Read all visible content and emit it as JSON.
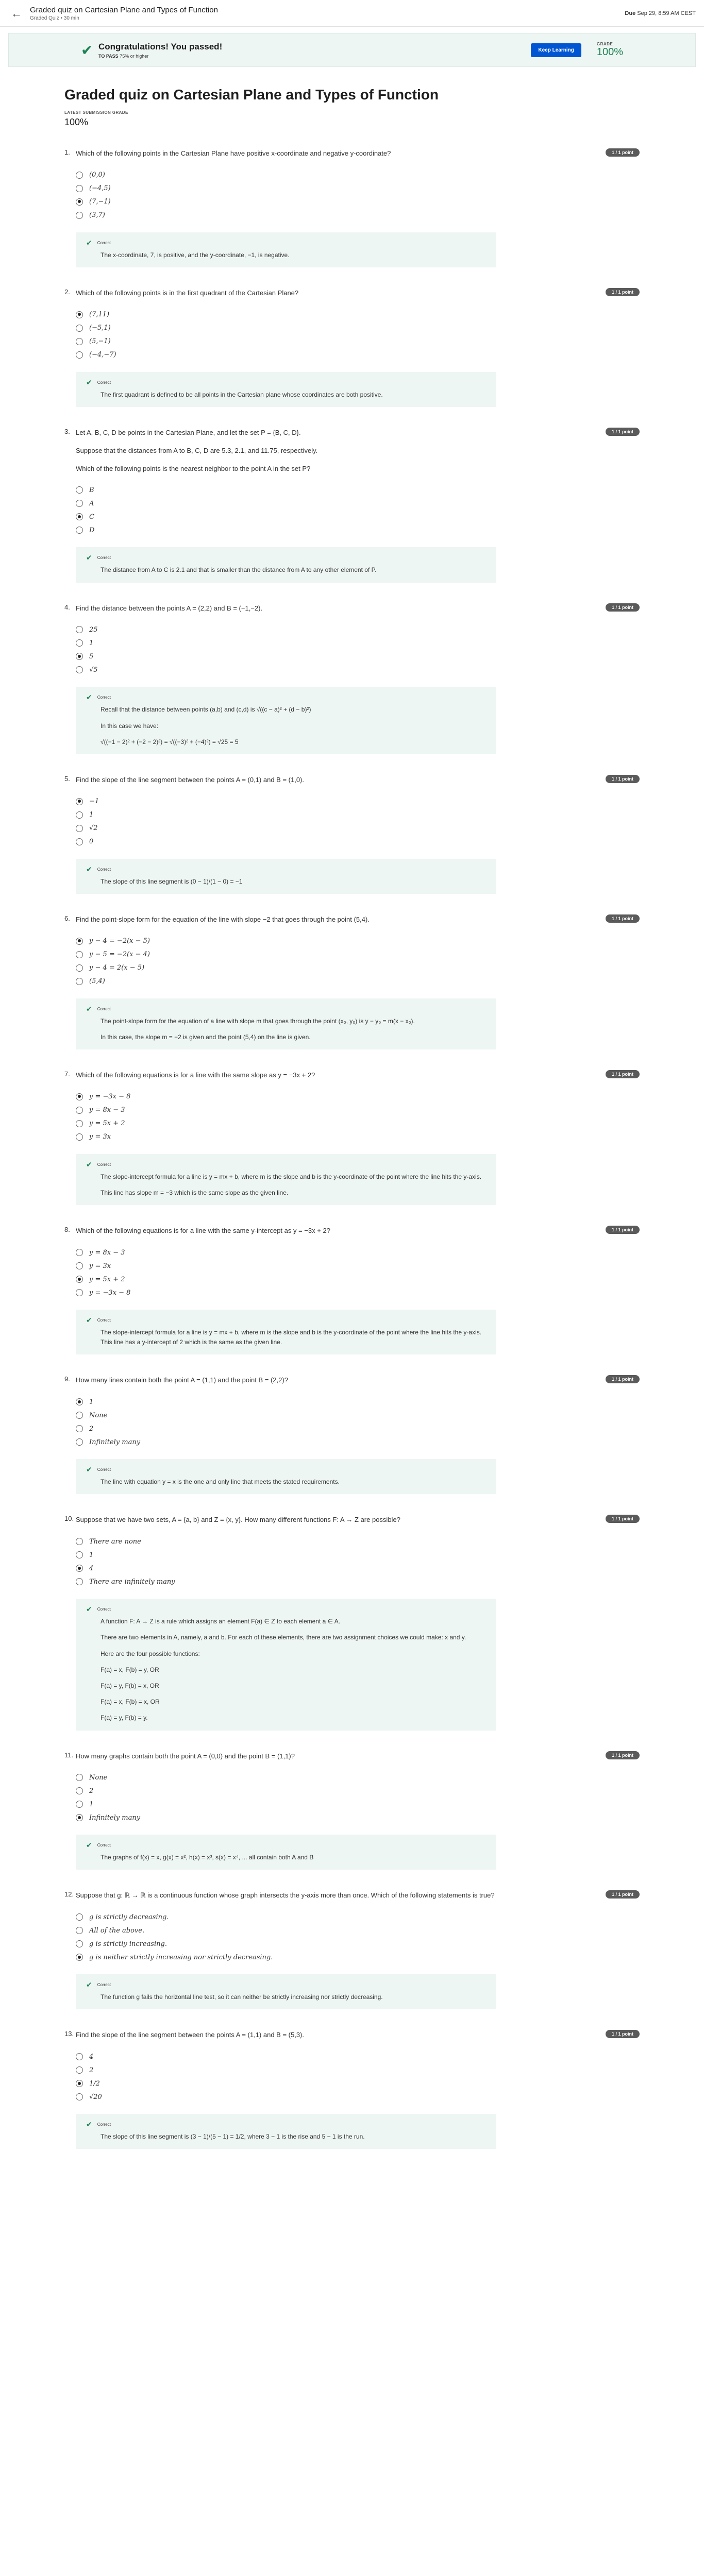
{
  "header": {
    "title": "Graded quiz on Cartesian Plane and Types of Function",
    "subtitle": "Graded Quiz • 30 min",
    "due_label": "Due",
    "due_value": "Sep 29, 8:59 AM CEST",
    "back_icon": "arrow-left-icon"
  },
  "banner": {
    "heading": "Congratulations! You passed!",
    "to_pass_label": "TO PASS",
    "to_pass_value": "75% or higher",
    "button": "Keep Learning",
    "grade_label": "GRADE",
    "grade_value": "100%",
    "accent": "#1f8354",
    "button_color": "#0056d2"
  },
  "main": {
    "title": "Graded quiz on Cartesian Plane and Types of Function",
    "latest_label": "LATEST SUBMISSION GRADE",
    "latest_value": "100%"
  },
  "questions": [
    {
      "num": "1.",
      "text": "Which of the following points in the Cartesian Plane have positive x-coordinate and negative y-coordinate?",
      "points": "1 / 1 point",
      "options": [
        "(0,0)",
        "(−4,5)",
        "(7,−1)",
        "(3,7)"
      ],
      "selected": 2,
      "fb_label": "Correct",
      "fb": [
        "The x-coordinate, 7, is positive, and the y-coordinate, −1, is negative."
      ]
    },
    {
      "num": "2.",
      "text": "Which of the following points is in the first quadrant of the Cartesian Plane?",
      "points": "1 / 1 point",
      "options": [
        "(7,11)",
        "(−5,1)",
        "(5,−1)",
        "(−4,−7)"
      ],
      "selected": 0,
      "fb_label": "Correct",
      "fb": [
        "The first quadrant is defined to be all points in the Cartesian plane whose coordinates are both positive."
      ]
    },
    {
      "num": "3.",
      "text": "Let A, B, C, D be points in the Cartesian Plane, and let the set P = {B, C, D}.",
      "sub": [
        "Suppose that the distances from A to B, C, D are 5.3, 2.1, and 11.75, respectively.",
        "Which of the following points is the nearest neighbor to the point A in the set P?"
      ],
      "points": "1 / 1 point",
      "options": [
        "B",
        "A",
        "C",
        "D"
      ],
      "selected": 2,
      "fb_label": "Correct",
      "fb": [
        "The distance from A to C is 2.1 and that is smaller than the distance from A to any other element of P."
      ]
    },
    {
      "num": "4.",
      "text": "Find the distance between the points A = (2,2) and B = (−1,−2).",
      "points": "1 / 1 point",
      "options": [
        "25",
        "1",
        "5",
        "√5"
      ],
      "selected": 2,
      "fb_label": "Correct",
      "fb": [
        "Recall that the distance between points (a,b) and (c,d) is √((c − a)² + (d − b)²)",
        "In this case we have:",
        "√((−1 − 2)² + (−2 − 2)²) = √((−3)² + (−4)²) = √25 = 5"
      ]
    },
    {
      "num": "5.",
      "text": "Find the slope of the line segment between the points A = (0,1) and B = (1,0).",
      "points": "1 / 1 point",
      "options": [
        "−1",
        "1",
        "√2",
        "0"
      ],
      "selected": 0,
      "fb_label": "Correct",
      "fb": [
        "The slope of this line segment is (0 − 1)/(1 − 0) = −1"
      ]
    },
    {
      "num": "6.",
      "text": "Find the point-slope form for the equation of the line with slope −2 that goes through the point (5,4).",
      "points": "1 / 1 point",
      "options": [
        "y − 4 = −2(x − 5)",
        "y − 5 = −2(x − 4)",
        "y − 4 = 2(x − 5)",
        "(5,4)"
      ],
      "selected": 0,
      "fb_label": "Correct",
      "fb": [
        "The point-slope form for the equation of a line with slope m that goes through the point (x₀, y₀) is y − y₀ = m(x − x₀).",
        "In this case, the slope m = −2 is given and the point (5,4) on the line is given."
      ]
    },
    {
      "num": "7.",
      "text": "Which of the following equations is for a line with the same slope as y = −3x + 2?",
      "points": "1 / 1 point",
      "options": [
        "y = −3x − 8",
        "y = 8x − 3",
        "y = 5x + 2",
        "y = 3x"
      ],
      "selected": 0,
      "fb_label": "Correct",
      "fb": [
        "The slope-intercept formula for a line is y = mx + b, where m is the slope and b is the y-coordinate of the point where the line hits the y-axis.",
        "This line has slope m = −3 which is the same slope as the given line."
      ]
    },
    {
      "num": "8.",
      "text": "Which of the following equations is for a line with the same y-intercept as y = −3x + 2?",
      "points": "1 / 1 point",
      "options": [
        "y = 8x − 3",
        "y = 3x",
        "y = 5x + 2",
        "y = −3x − 8"
      ],
      "selected": 2,
      "fb_label": "Correct",
      "fb": [
        "The slope-intercept formula for a line is y = mx + b, where m is the slope and b is the y-coordinate of the point where the line hits the y-axis. This line has a y-intercept of 2 which is the same as the given line."
      ]
    },
    {
      "num": "9.",
      "text": "How many lines contain both the point A = (1,1) and the point B = (2,2)?",
      "points": "1 / 1 point",
      "options": [
        "1",
        "None",
        "2",
        "Infinitely many"
      ],
      "selected": 0,
      "fb_label": "Correct",
      "fb": [
        "The line with equation y = x is the one and only line that meets the stated requirements."
      ]
    },
    {
      "num": "10.",
      "text": "Suppose that we have two sets, A = {a, b} and Z = {x, y}. How many different functions F: A → Z are possible?",
      "points": "1 / 1 point",
      "options": [
        "There are none",
        "1",
        "4",
        "There are infinitely many"
      ],
      "selected": 2,
      "fb_label": "Correct",
      "fb": [
        "A function F: A → Z is a rule which assigns an element F(a) ∈ Z to each element a ∈ A.",
        "There are two elements in A, namely, a and b. For each of these elements, there are two assignment choices we could make: x and y.",
        "Here are the four possible functions:",
        "F(a) = x, F(b) = y, OR",
        "F(a) = y, F(b) = x, OR",
        "F(a) = x, F(b) = x, OR",
        "F(a) = y, F(b) = y."
      ]
    },
    {
      "num": "11.",
      "text": "How many graphs contain both the point A = (0,0) and the point B = (1,1)?",
      "points": "1 / 1 point",
      "options": [
        "None",
        "2",
        "1",
        "Infinitely many"
      ],
      "selected": 3,
      "fb_label": "Correct",
      "fb": [
        "The graphs of f(x) = x, g(x) = x², h(x) = x³, s(x) = x⁴, ... all contain both A and B"
      ]
    },
    {
      "num": "12.",
      "text": "Suppose that g: ℝ → ℝ is a continuous function whose graph intersects the y-axis more than once. Which of the following statements is true?",
      "points": "1 / 1 point",
      "options": [
        "g is strictly decreasing.",
        "All of the above.",
        "g is strictly increasing.",
        "g is neither strictly increasing nor strictly decreasing."
      ],
      "selected": 3,
      "fb_label": "Correct",
      "fb": [
        "The function g fails the horizontal line test, so it can neither be strictly increasing nor strictly decreasing."
      ]
    },
    {
      "num": "13.",
      "text": "Find the slope of the line segment between the points A = (1,1) and B = (5,3).",
      "points": "1 / 1 point",
      "options": [
        "4",
        "2",
        "1/2",
        "√20"
      ],
      "selected": 2,
      "fb_label": "Correct",
      "fb": [
        "The slope of this line segment is (3 − 1)/(5 − 1) = 1/2, where 3 − 1 is the rise and 5 − 1 is the run."
      ]
    }
  ]
}
